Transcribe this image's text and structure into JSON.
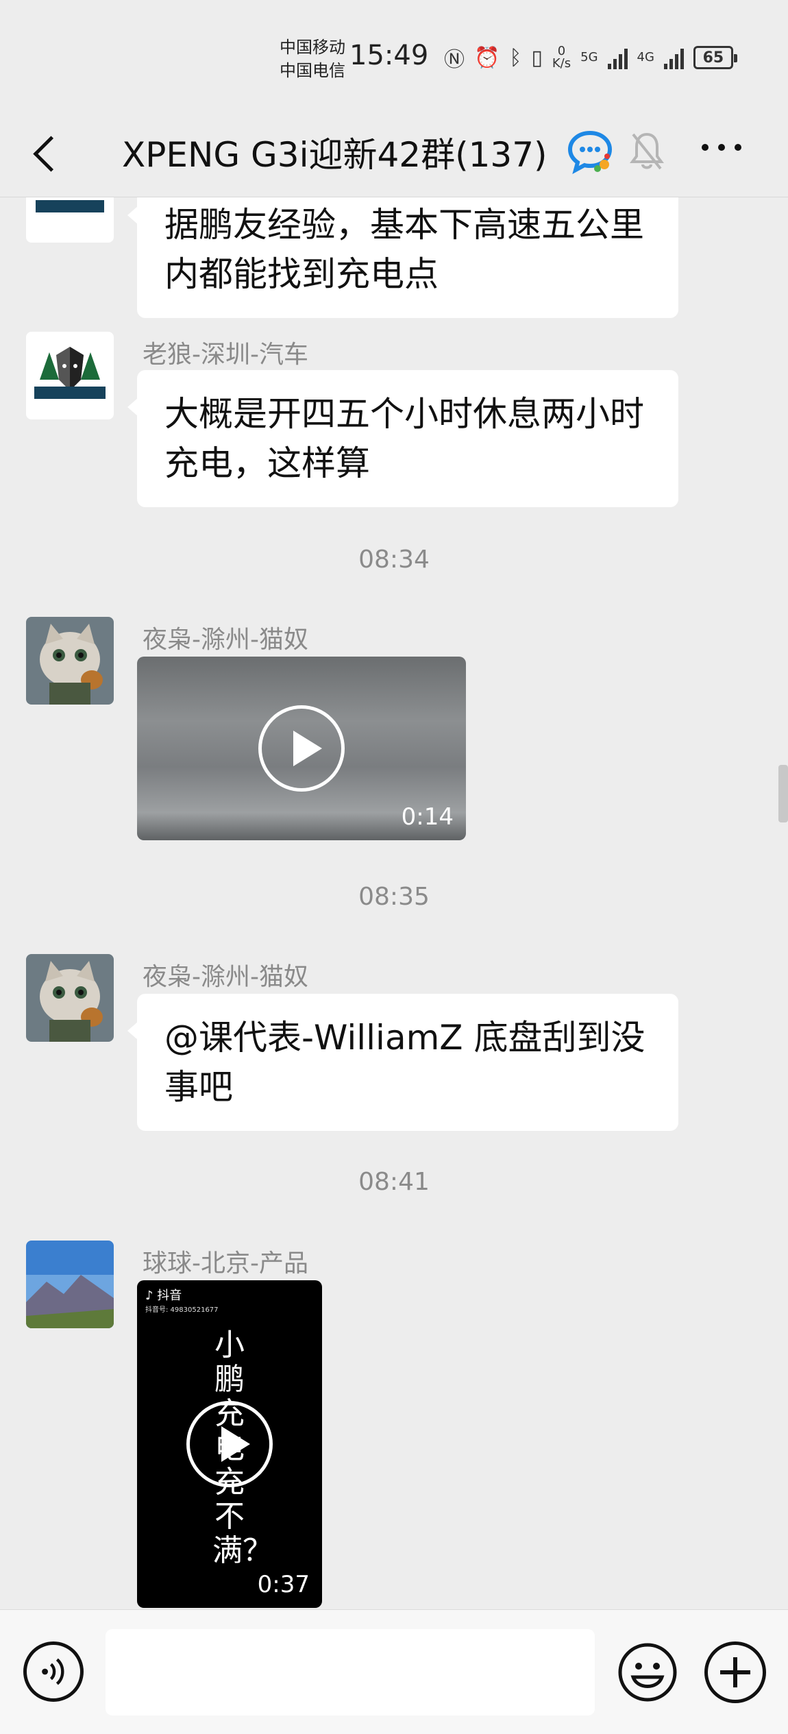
{
  "status_bar": {
    "carrier1": "中国移动",
    "carrier2": "中国电信",
    "time": "15:49",
    "speed_value": "0",
    "speed_unit": "K/s",
    "net1": "5G",
    "net2": "4G",
    "battery": "65"
  },
  "header": {
    "title": "XPENG G3i迎新42群(137)"
  },
  "messages": [
    {
      "text": "据鹏友经验，基本下高速五公里内都能找到充电点"
    },
    {
      "sender": "老狼-深圳-汽车",
      "text": "大概是开四五个小时休息两小时充电，这样算"
    },
    {
      "time": "08:34"
    },
    {
      "sender": "夜枭-滁州-猫奴",
      "duration": "0:14"
    },
    {
      "time": "08:35"
    },
    {
      "sender": "夜枭-滁州-猫奴",
      "text": "@课代表-WilliamZ  底盘刮到没事吧"
    },
    {
      "time": "08:41"
    },
    {
      "sender": "球球-北京-产品",
      "duration": "0:37",
      "video_app": "抖音",
      "video_id": "抖音号: 49830521677",
      "video_caption": "小鹏充电充不满？"
    }
  ],
  "colors": {
    "background": "#ededed",
    "bubble": "#ffffff",
    "meta_text": "#8a8a8a"
  },
  "icons": [
    "back-arrow-icon",
    "tencent-meeting-icon",
    "bell-mute-icon",
    "more-icon",
    "play-icon",
    "voice-icon",
    "emoji-icon",
    "plus-icon"
  ]
}
